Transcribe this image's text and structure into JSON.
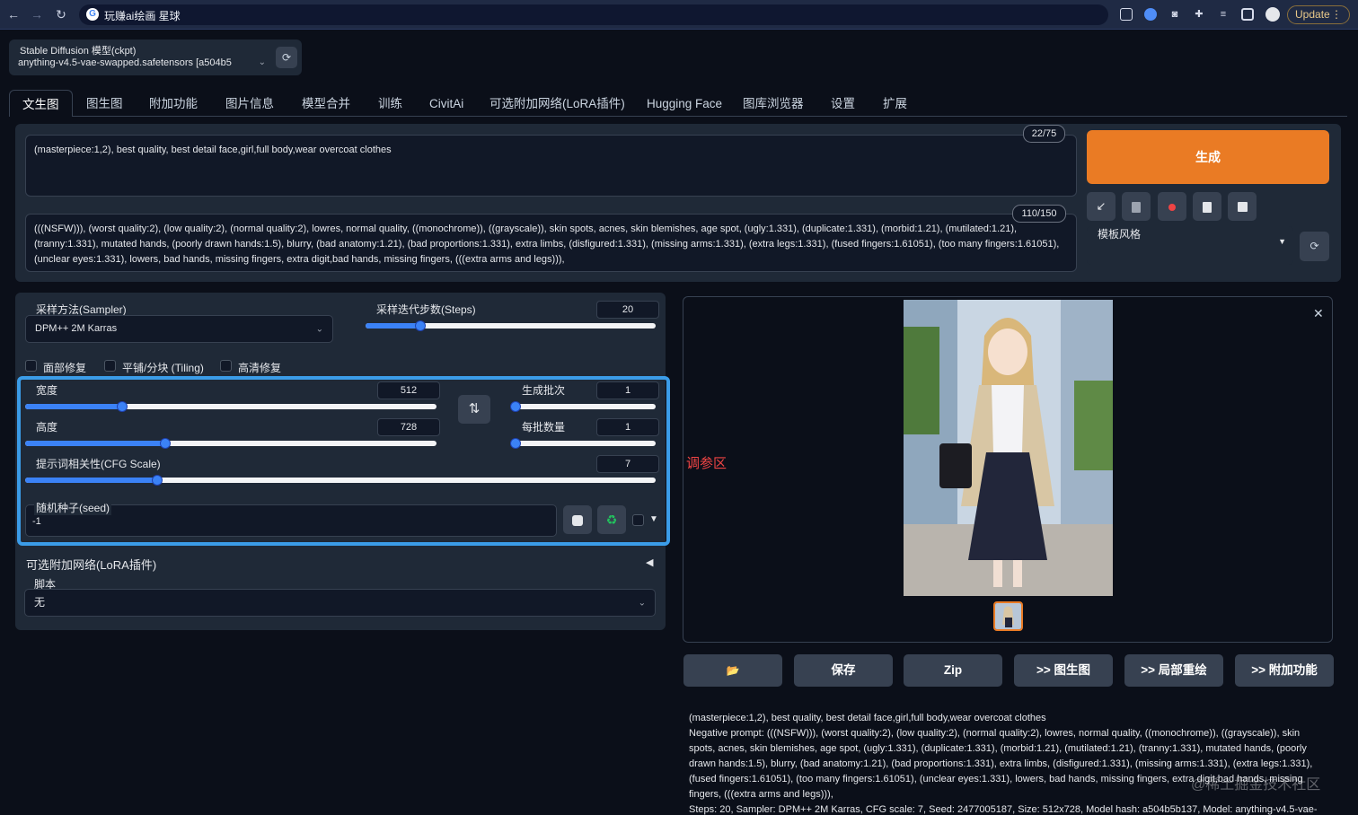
{
  "browser": {
    "tab_title": "玩赚ai绘画 星球",
    "update_label": "Update",
    "update_menu": "⋮"
  },
  "model": {
    "label": "Stable Diffusion 模型(ckpt)",
    "value": "anything-v4.5-vae-swapped.safetensors [a504b5"
  },
  "tabs": [
    "文生图",
    "图生图",
    "附加功能",
    "图片信息",
    "模型合并",
    "训练",
    "CivitAi",
    "可选附加网络(LoRA插件)",
    "Hugging Face",
    "图库浏览器",
    "设置",
    "扩展"
  ],
  "prompt": {
    "positive": "(masterpiece:1,2), best quality, best detail face,girl,full body,wear overcoat clothes",
    "positive_tokens": "22/75",
    "negative": "(((NSFW))), (worst quality:2), (low quality:2), (normal quality:2), lowres, normal quality, ((monochrome)), ((grayscale)), skin spots, acnes, skin blemishes, age spot, (ugly:1.331), (duplicate:1.331), (morbid:1.21), (mutilated:1.21), (tranny:1.331), mutated hands, (poorly drawn hands:1.5), blurry, (bad anatomy:1.21), (bad proportions:1.331), extra limbs, (disfigured:1.331), (missing arms:1.331), (extra legs:1.331), (fused fingers:1.61051), (too many fingers:1.61051), (unclear eyes:1.331), lowers, bad hands, missing fingers, extra digit,bad hands, missing fingers, (((extra arms and legs))),",
    "negative_tokens": "110/150"
  },
  "generate_label": "生成",
  "style_label": "模板风格",
  "settings": {
    "sampler_label": "采样方法(Sampler)",
    "sampler_value": "DPM++ 2M Karras",
    "steps_label": "采样迭代步数(Steps)",
    "steps_value": "20",
    "steps_fraction": 0.19,
    "face_restore": "面部修复",
    "tiling": "平铺/分块 (Tiling)",
    "hires": "高清修复",
    "width_label": "宽度",
    "width_value": "512",
    "width_fraction": 0.235,
    "height_label": "高度",
    "height_value": "728",
    "height_fraction": 0.34,
    "batch_count_label": "生成批次",
    "batch_count_value": "1",
    "batch_count_fraction": 0.0,
    "batch_size_label": "每批数量",
    "batch_size_value": "1",
    "batch_size_fraction": 0.0,
    "cfg_label": "提示词相关性(CFG Scale)",
    "cfg_value": "7",
    "cfg_fraction": 0.21,
    "seed_label": "随机种子(seed)",
    "seed_value": "-1",
    "seed_arrow": "▼",
    "lora_label": "可选附加网络(LoRA插件)",
    "lora_toggle": "◀",
    "script_label": "脚本",
    "script_value": "无"
  },
  "annotation": "调参区",
  "output_buttons": [
    "📂",
    "保存",
    "Zip",
    ">> 图生图",
    ">> 局部重绘",
    ">> 附加功能"
  ],
  "gen_info": {
    "line1": "(masterpiece:1,2), best quality, best detail face,girl,full body,wear overcoat clothes",
    "line2": "Negative prompt: (((NSFW))), (worst quality:2), (low quality:2), (normal quality:2), lowres, normal quality, ((monochrome)), ((grayscale)), skin spots, acnes, skin blemishes, age spot, (ugly:1.331), (duplicate:1.331), (morbid:1.21), (mutilated:1.21), (tranny:1.331), mutated hands, (poorly drawn hands:1.5), blurry, (bad anatomy:1.21), (bad proportions:1.331), extra limbs, (disfigured:1.331), (missing arms:1.331), (extra legs:1.331), (fused fingers:1.61051), (too many fingers:1.61051), (unclear eyes:1.331), lowers, bad hands, missing fingers, extra digit,bad hands, missing fingers, (((extra arms and legs))),",
    "line3": "Steps: 20, Sampler: DPM++ 2M Karras, CFG scale: 7, Seed: 2477005187, Size: 512x728, Model hash: a504b5b137, Model: anything-v4.5-vae-"
  },
  "watermark": "@稀土掘金技术社区",
  "colors": {
    "accent": "#ea7b24",
    "slider": "#3b82f6",
    "highlight": "#3b9ce8",
    "annotation": "#ef4444"
  }
}
